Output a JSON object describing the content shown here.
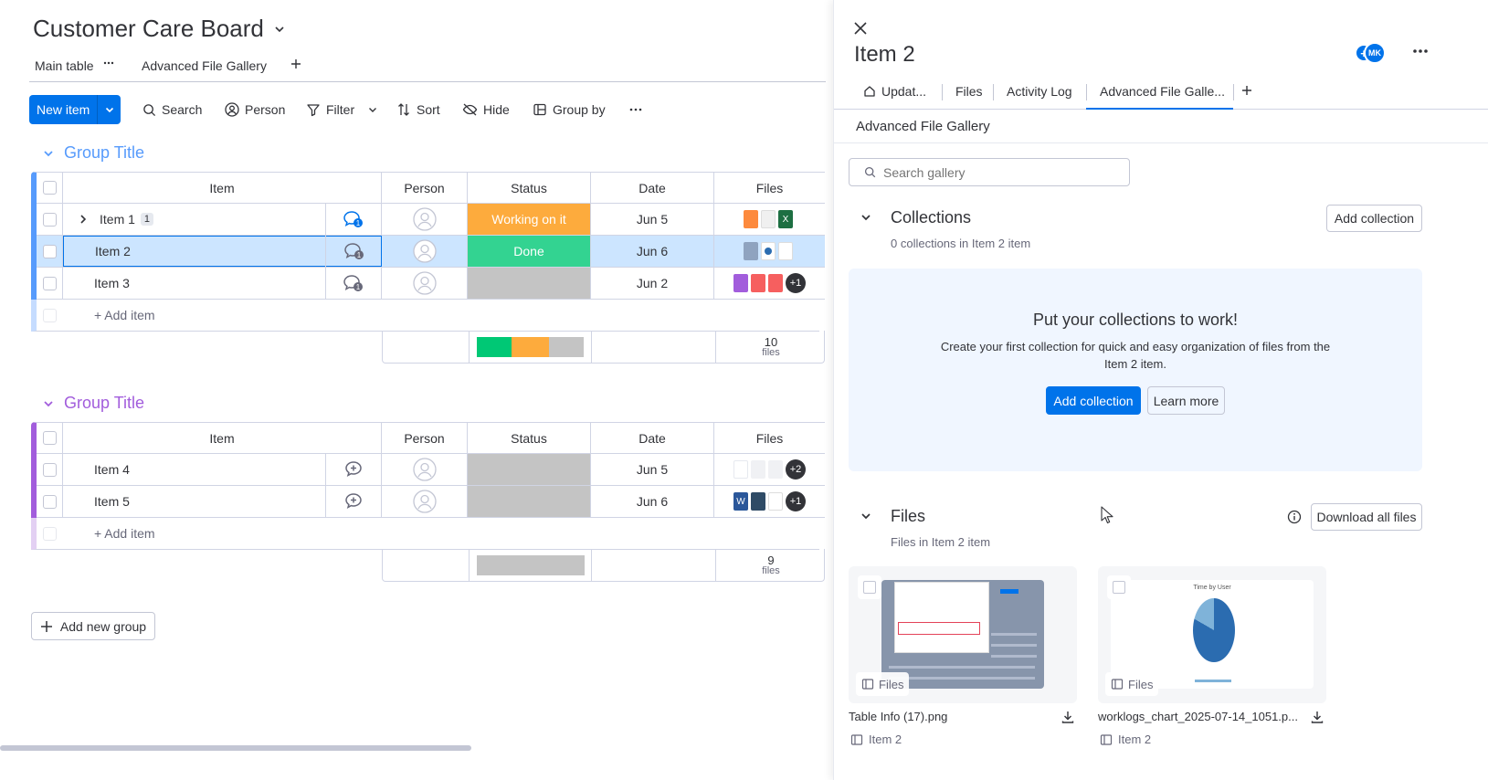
{
  "board": {
    "title": "Customer Care Board",
    "tabs": [
      {
        "label": "Main table"
      },
      {
        "label": "Advanced File Gallery"
      }
    ],
    "toolbar": {
      "new_item": "New item",
      "search": "Search",
      "person": "Person",
      "filter": "Filter",
      "sort": "Sort",
      "hide": "Hide",
      "group_by": "Group by"
    },
    "columns": {
      "item": "Item",
      "person": "Person",
      "status": "Status",
      "date": "Date",
      "files": "Files"
    },
    "groups": [
      {
        "title": "Group Title",
        "color": "#579bfc",
        "rows": [
          {
            "name": "Item 1",
            "subitems": "1",
            "updates": "1",
            "status": "Working on it",
            "status_color": "#fdab3d",
            "date": "Jun 5",
            "files_more": ""
          },
          {
            "name": "Item 2",
            "subitems": "",
            "updates": "1",
            "status": "Done",
            "status_color": "#00c875",
            "date": "Jun 6",
            "files_more": ""
          },
          {
            "name": "Item 3",
            "subitems": "",
            "updates": "1",
            "status": "",
            "status_color": "#c4c4c4",
            "date": "Jun 2",
            "files_more": "+1"
          }
        ],
        "add_item": "+ Add item",
        "files_count": "10",
        "files_unit": "files"
      },
      {
        "title": "Group Title",
        "color": "#a25ddc",
        "rows": [
          {
            "name": "Item 4",
            "subitems": "",
            "updates": "",
            "status": "",
            "status_color": "#c4c4c4",
            "date": "Jun 5",
            "files_more": "+2"
          },
          {
            "name": "Item 5",
            "subitems": "",
            "updates": "",
            "status": "",
            "status_color": "#c4c4c4",
            "date": "Jun 6",
            "files_more": "+1"
          }
        ],
        "add_item": "+ Add item",
        "files_count": "9",
        "files_unit": "files"
      }
    ],
    "add_group": "Add new group"
  },
  "panel": {
    "title": "Item 2",
    "avatar_initials": "MK",
    "tabs": [
      {
        "label": "Updat..."
      },
      {
        "label": "Files"
      },
      {
        "label": "Activity Log"
      },
      {
        "label": "Advanced File Galle..."
      }
    ],
    "app_title": "Advanced File Gallery",
    "search_placeholder": "Search gallery",
    "collections": {
      "heading": "Collections",
      "subtitle": "0 collections in Item 2 item",
      "add_button": "Add collection",
      "empty_title": "Put your collections to work!",
      "empty_text": "Create your first collection for quick and easy organization of files from the Item 2 item.",
      "empty_add_button": "Add collection",
      "learn_more": "Learn more"
    },
    "files": {
      "heading": "Files",
      "subtitle": "Files in Item 2 item",
      "download_all": "Download all files",
      "cards": [
        {
          "name": "Table Info (17).png",
          "tag": "Files",
          "item": "Item 2"
        },
        {
          "name": "worklogs_chart_2025-07-14_1051.p...",
          "tag": "Files",
          "item": "Item 2"
        }
      ]
    }
  },
  "colors": {
    "primary": "#0073ea",
    "done": "#00c875",
    "working": "#fdab3d",
    "empty": "#c4c4c4"
  }
}
